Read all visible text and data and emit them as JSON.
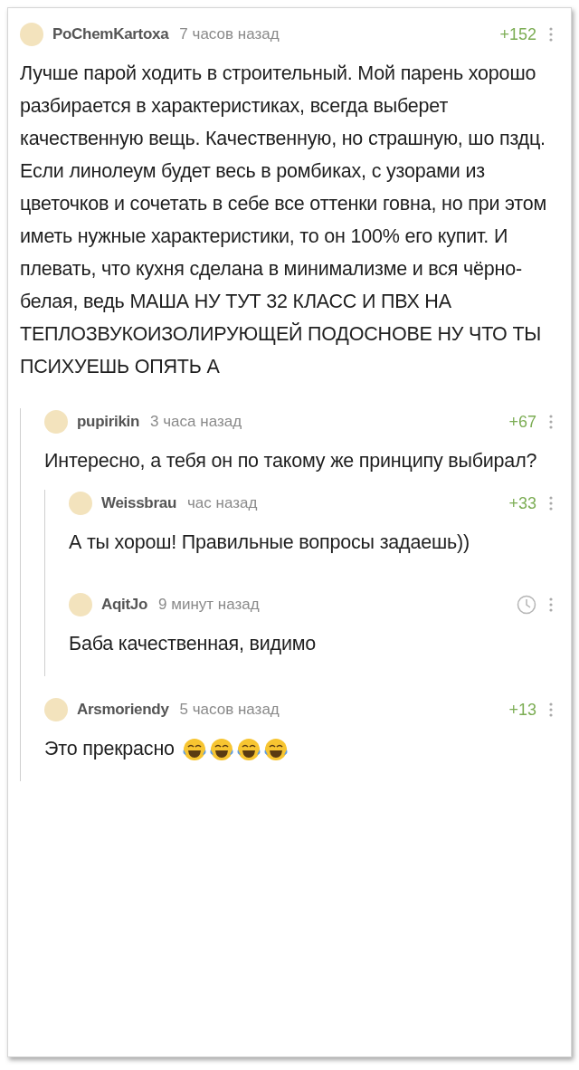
{
  "comments": [
    {
      "author": "PoChemKartoxa",
      "time": "7 часов назад",
      "score": "+152",
      "score_hidden": false,
      "text": "Лучше парой ходить в строительный. Мой парень хорошо разбирается в характеристиках, всегда выберет качественную вещь. Качественную, но страшную, шо пздц. Если линолеум будет весь в ромбиках, с узорами из цветочков и сочетать в себе все оттенки говна, но при этом иметь нужные характеристики, то он 100% его купит. И плевать, что кухня сделана в минимализме и вся чёрно-белая, ведь МАША НУ ТУТ 32 КЛАСС И ПВХ НА ТЕПЛОЗВУКОИЗОЛИРУЮЩЕЙ ПОДОСНОВЕ НУ ЧТО ТЫ ПСИХУЕШЬ ОПЯТЬ А",
      "children": [
        {
          "author": "pupirikin",
          "time": "3 часа назад",
          "score": "+67",
          "score_hidden": false,
          "text": "Интересно, а тебя он по такому же принципу выбирал?",
          "children": [
            {
              "author": "Weissbrau",
              "time": "час назад",
              "score": "+33",
              "score_hidden": false,
              "text": "А ты хорош! Правильные вопросы задаешь))"
            },
            {
              "author": "AqitJo",
              "time": "9 минут назад",
              "score_hidden": true,
              "text": "Баба качественная, видимо"
            }
          ]
        },
        {
          "author": "Arsmoriendy",
          "time": "5 часов назад",
          "score": "+13",
          "score_hidden": false,
          "text": "Это прекрасно",
          "reactions": [
            {
              "kind": "laughing"
            },
            {
              "kind": "laughing"
            },
            {
              "kind": "laughing"
            },
            {
              "kind": "laughing"
            }
          ]
        }
      ]
    }
  ]
}
